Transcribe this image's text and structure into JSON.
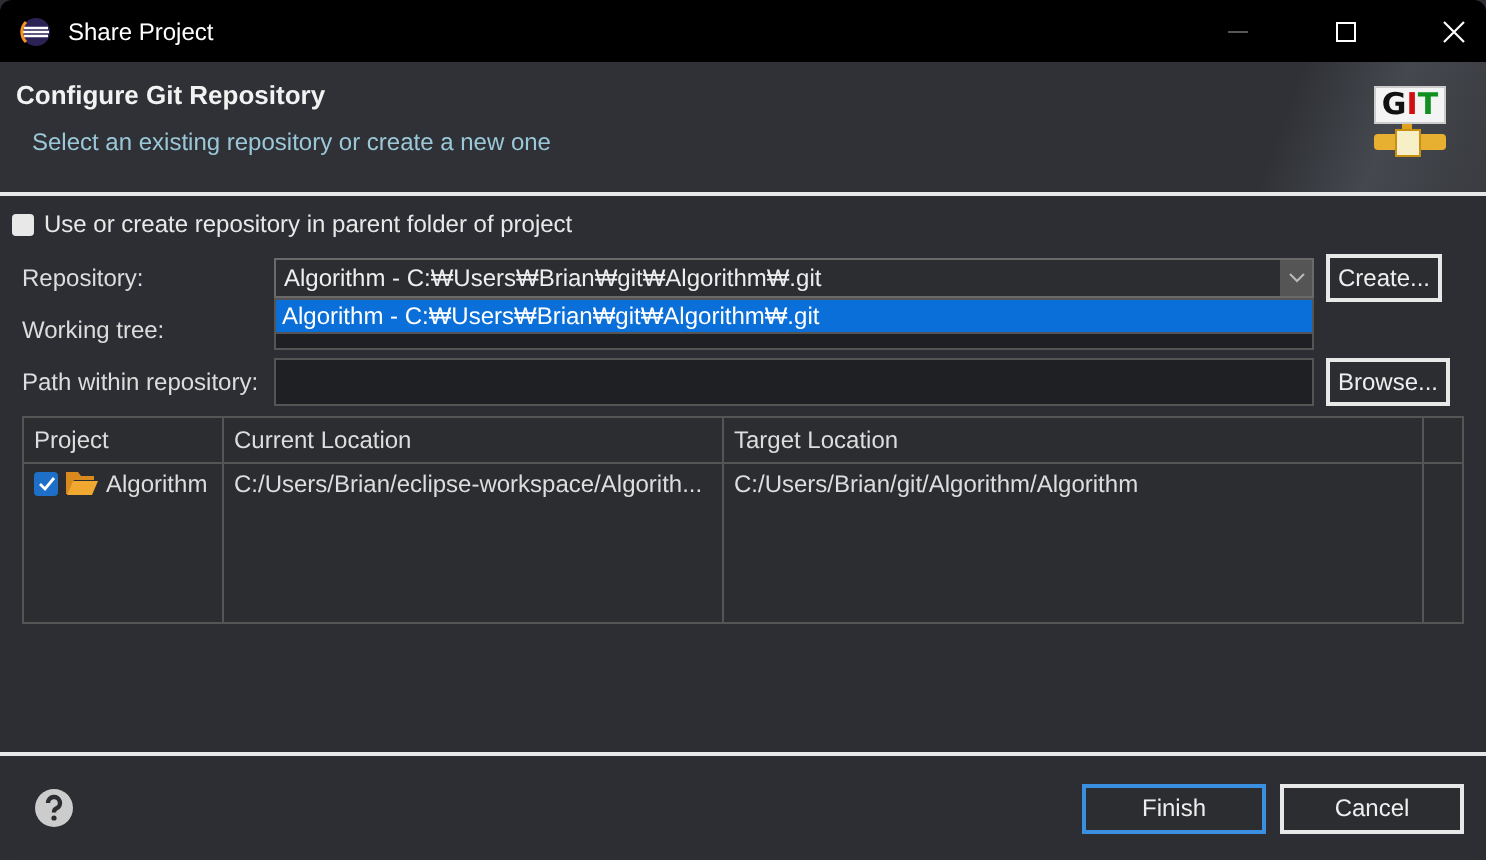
{
  "window": {
    "title": "Share Project"
  },
  "header": {
    "title": "Configure Git Repository",
    "subtitle": "Select an existing repository or create a new one",
    "logo": [
      {
        "char": "G",
        "color": "#111111"
      },
      {
        "char": "I",
        "color": "#d01010"
      },
      {
        "char": "T",
        "color": "#109020"
      }
    ]
  },
  "parent_option": {
    "label": "Use or create repository in parent folder of project",
    "checked": false
  },
  "repository": {
    "label": "Repository:",
    "value": "Algorithm - C:₩Users₩Brian₩git₩Algorithm₩.git",
    "expanded": true,
    "options": [
      {
        "label": "Algorithm - C:₩Users₩Brian₩git₩Algorithm₩.git",
        "selected": true
      }
    ],
    "button": "Create..."
  },
  "working_tree": {
    "label": "Working tree:"
  },
  "path": {
    "label": "Path within repository:",
    "button": "Browse..."
  },
  "table": {
    "columns": [
      "Project",
      "Current Location",
      "Target Location"
    ],
    "rows": [
      {
        "checked": true,
        "project": "Algorithm",
        "current": "C:/Users/Brian/eclipse-workspace/Algorith...",
        "target": "C:/Users/Brian/git/Algorithm/Algorithm"
      }
    ]
  },
  "buttons": [
    {
      "label": "Finish",
      "default": true
    },
    {
      "label": "Cancel",
      "default": false
    }
  ]
}
